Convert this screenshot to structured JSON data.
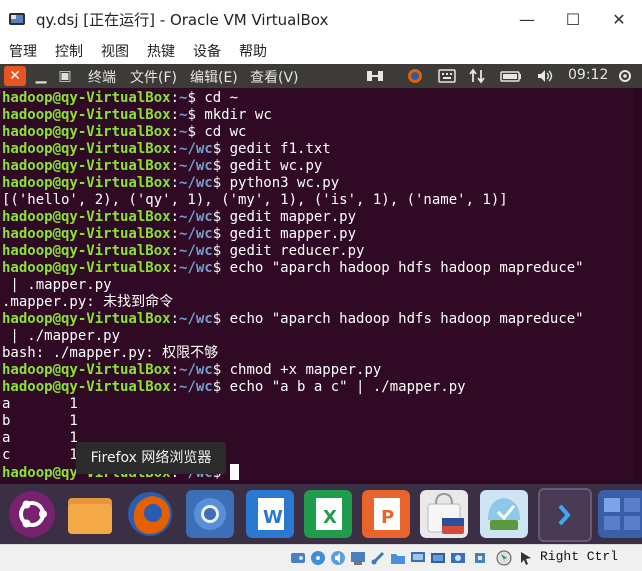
{
  "window": {
    "title": "qy.dsj [正在运行] - Oracle VM VirtualBox",
    "minimize_glyph": "—",
    "maximize_glyph": "☐",
    "close_glyph": "✕"
  },
  "vbox_menu": [
    "管理",
    "控制",
    "视图",
    "热键",
    "设备",
    "帮助"
  ],
  "panel": {
    "close_glyph": "✕",
    "minimize_glyph": "▁",
    "restore_glyph": "▣",
    "menus": [
      "终端",
      "文件(F)",
      "编辑(E)",
      "查看(V)"
    ],
    "clock": "09:12",
    "icons": [
      "network-transfer-icon",
      "keyboard-icon",
      "sort-arrows-icon",
      "battery-icon",
      "volume-icon",
      "power-gear-icon"
    ]
  },
  "terminal": {
    "user": "hadoop@qy-VirtualBox",
    "lines": [
      {
        "prompt": true,
        "path": "~",
        "cmd": "cd ~"
      },
      {
        "prompt": true,
        "path": "~",
        "cmd": "mkdir wc"
      },
      {
        "prompt": true,
        "path": "~",
        "cmd": "cd wc"
      },
      {
        "prompt": true,
        "path": "~/wc",
        "cmd": "gedit f1.txt"
      },
      {
        "prompt": true,
        "path": "~/wc",
        "cmd": "gedit wc.py"
      },
      {
        "prompt": true,
        "path": "~/wc",
        "cmd": "python3 wc.py"
      },
      {
        "prompt": false,
        "text": "[('hello', 2), ('qy', 1), ('my', 1), ('is', 1), ('name', 1)]"
      },
      {
        "prompt": true,
        "path": "~/wc",
        "cmd": "gedit mapper.py"
      },
      {
        "prompt": true,
        "path": "~/wc",
        "cmd": "gedit mapper.py"
      },
      {
        "prompt": true,
        "path": "~/wc",
        "cmd": "gedit reducer.py"
      },
      {
        "prompt": true,
        "path": "~/wc",
        "cmd": "echo \"aparch hadoop hdfs hadoop mapreduce\""
      },
      {
        "prompt": false,
        "text": " | .mapper.py"
      },
      {
        "prompt": false,
        "text": ".mapper.py: 未找到命令"
      },
      {
        "prompt": true,
        "path": "~/wc",
        "cmd": "echo \"aparch hadoop hdfs hadoop mapreduce\""
      },
      {
        "prompt": false,
        "text": " | ./mapper.py"
      },
      {
        "prompt": false,
        "text": "bash: ./mapper.py: 权限不够"
      },
      {
        "prompt": true,
        "path": "~/wc",
        "cmd": "chmod +x mapper.py"
      },
      {
        "prompt": true,
        "path": "~/wc",
        "cmd": "echo \"a b a c\" | ./mapper.py"
      },
      {
        "prompt": false,
        "text": "a       1"
      },
      {
        "prompt": false,
        "text": "b       1"
      },
      {
        "prompt": false,
        "text": "a       1"
      },
      {
        "prompt": false,
        "text": "c       1"
      },
      {
        "prompt": true,
        "path": "~/wc",
        "cmd": "",
        "cursor": true
      }
    ]
  },
  "tooltip": "Firefox 网络浏览器",
  "dock_items": [
    {
      "name": "ubuntu-dash-icon",
      "color": "#77216f"
    },
    {
      "name": "files-icon",
      "color": "#f0a430"
    },
    {
      "name": "firefox-icon",
      "color": "#e66000"
    },
    {
      "name": "chromium-icon",
      "color": "#3c6fb8"
    },
    {
      "name": "wps-writer-icon",
      "color": "#2b78d0"
    },
    {
      "name": "wps-spreadsheet-icon",
      "color": "#1f9d4c"
    },
    {
      "name": "wps-presentation-icon",
      "color": "#e8642c"
    },
    {
      "name": "ubuntu-software-icon",
      "color": "#e9e9e9"
    },
    {
      "name": "software-updater-icon",
      "color": "#cfe4f3"
    },
    {
      "name": "terminal-icon",
      "color": "#4a3b55"
    },
    {
      "name": "workspace-switcher-icon",
      "color": "#3a5ea8"
    }
  ],
  "statusbar": {
    "host_key": "Right Ctrl",
    "icons": [
      "hard-disk-icon",
      "optical-drive-icon",
      "audio-icon",
      "network-icon",
      "usb-icon",
      "shared-folders-icon",
      "display-icon",
      "recording-icon",
      "cpu-icon",
      "mouse-integration-icon",
      "keyboard-capture-icon"
    ]
  },
  "colors": {
    "terminal_bg": "#300a24",
    "prompt_user": "#8ae234",
    "prompt_path": "#729fcf",
    "panel_bg": "#3c3b37",
    "accent": "#e95420"
  }
}
